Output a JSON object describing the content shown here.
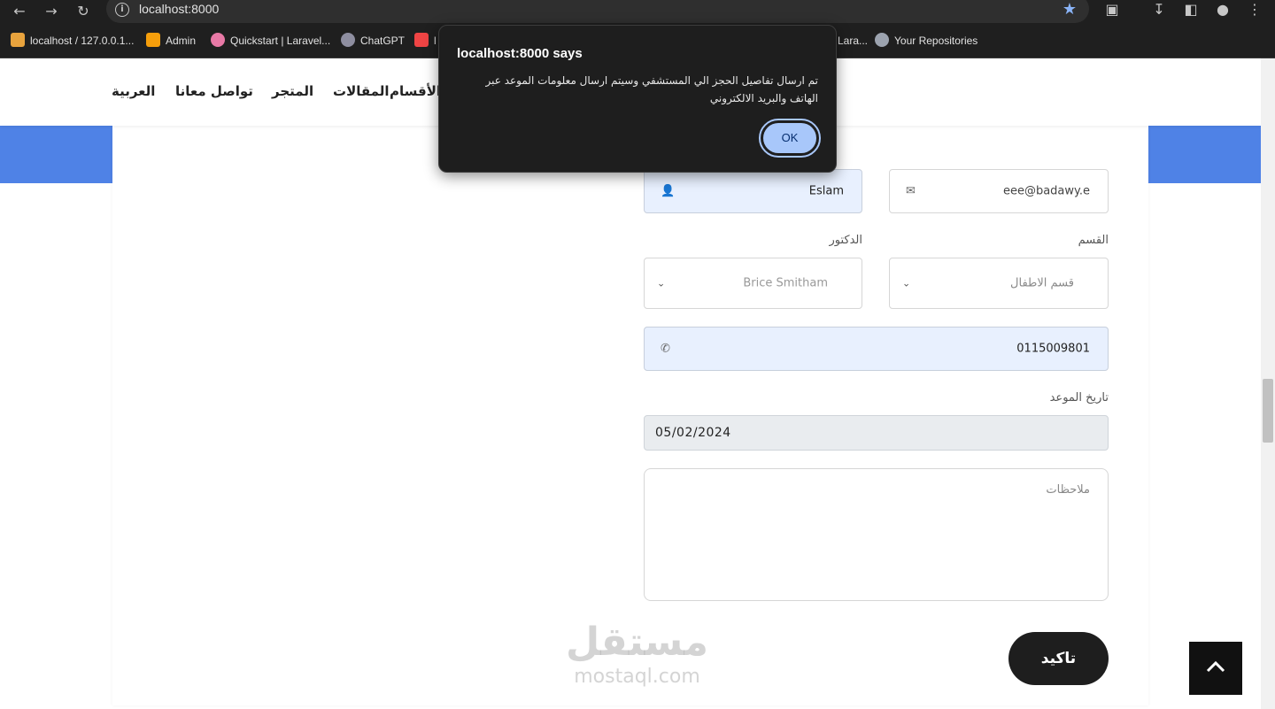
{
  "browser": {
    "url": "localhost:8000",
    "bookmarks": [
      {
        "label": "localhost / 127.0.0.1...",
        "color": "#e8a33d"
      },
      {
        "label": "Admin",
        "color": "#f59e0b"
      },
      {
        "label": "Quickstart | Laravel...",
        "color": "#e879a6"
      },
      {
        "label": "ChatGPT",
        "color": "#8e8ea0"
      },
      {
        "label": "l",
        "color": "#ef4444"
      },
      {
        "label": "Lara...",
        "color": "#ef4444"
      },
      {
        "label": "Your Repositories",
        "color": "#9ca3af"
      }
    ]
  },
  "nav": {
    "items": [
      "العربية",
      "تواصل معانا",
      "المتجر",
      "المقالات",
      "الأقسام"
    ]
  },
  "form": {
    "name_value": "Eslam",
    "email_value": "eee@badawy.e",
    "doctor_label": "الدكتور",
    "doctor_value": "Brice Smitham",
    "department_label": "القسم",
    "department_value": "قسم الاطفال",
    "phone_value": "0115009801",
    "date_label": "تاريخ الموعد",
    "date_value": "05/02/2024",
    "notes_placeholder": "ملاحظات",
    "submit_label": "تاكيد"
  },
  "watermark": {
    "arabic": "مستقل",
    "latin": "mostaql.com"
  },
  "dialog": {
    "title": "localhost:8000 says",
    "message": "تم ارسال تفاصيل الحجز الي المستشفي وسيتم ارسال معلومات الموعد عبر الهاتف والبريد الالكتروني",
    "ok_label": "OK"
  },
  "colors": {
    "accent_blue": "#4f82e6",
    "dialog_button": "#a8c7fa",
    "autofill": "#e8f0fe"
  }
}
